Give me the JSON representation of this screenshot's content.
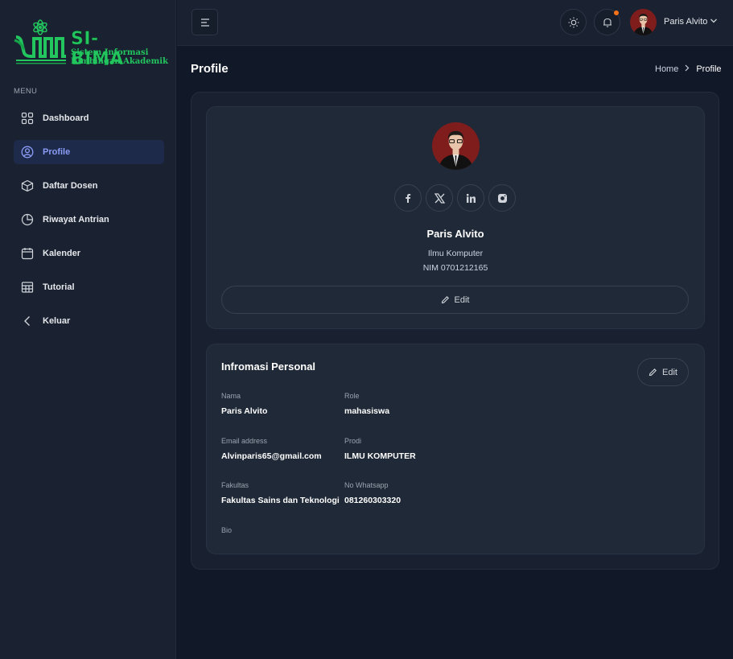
{
  "app": {
    "logo_main": "SI-BIMA",
    "logo_sub1": "Sistem Informasi",
    "logo_sub2": "Bimbingan Akademik"
  },
  "sidebar": {
    "heading": "MENU",
    "items": [
      {
        "label": "Dashboard",
        "icon": "grid-icon"
      },
      {
        "label": "Profile",
        "icon": "user-circle-icon",
        "active": true
      },
      {
        "label": "Daftar Dosen",
        "icon": "cube-icon"
      },
      {
        "label": "Riwayat Antrian",
        "icon": "pie-chart-icon"
      },
      {
        "label": "Kalender",
        "icon": "calendar-icon"
      },
      {
        "label": "Tutorial",
        "icon": "table-icon"
      },
      {
        "label": "Keluar",
        "icon": "chevron-left-icon"
      }
    ]
  },
  "header": {
    "user_name": "Paris Alvito",
    "has_notification": true
  },
  "page": {
    "title": "Profile",
    "breadcrumb": [
      "Home",
      "Profile"
    ]
  },
  "profile": {
    "name": "Paris Alvito",
    "program": "Ilmu Komputer",
    "nim": "NIM 0701212165",
    "edit_label": "Edit",
    "socials": [
      "facebook-icon",
      "x-icon",
      "linkedin-icon",
      "instagram-icon"
    ]
  },
  "info": {
    "title": "Infromasi Personal",
    "edit_label": "Edit",
    "fields": {
      "nama": {
        "label": "Nama",
        "value": "Paris Alvito"
      },
      "role": {
        "label": "Role",
        "value": "mahasiswa"
      },
      "email": {
        "label": "Email address",
        "value": "Alvinparis65@gmail.com"
      },
      "prodi": {
        "label": "Prodi",
        "value": "ILMU KOMPUTER"
      },
      "fakultas": {
        "label": "Fakultas",
        "value": "Fakultas Sains dan Teknologi"
      },
      "whatsapp": {
        "label": "No Whatsapp",
        "value": "081260303320"
      },
      "bio": {
        "label": "Bio",
        "value": ""
      }
    }
  },
  "colors": {
    "background": "#111827",
    "sidebar": "#1a2231",
    "card": "#1f2937",
    "accent": "#8b9cf6",
    "logo_green": "#22c55e",
    "notify": "#f97316"
  }
}
